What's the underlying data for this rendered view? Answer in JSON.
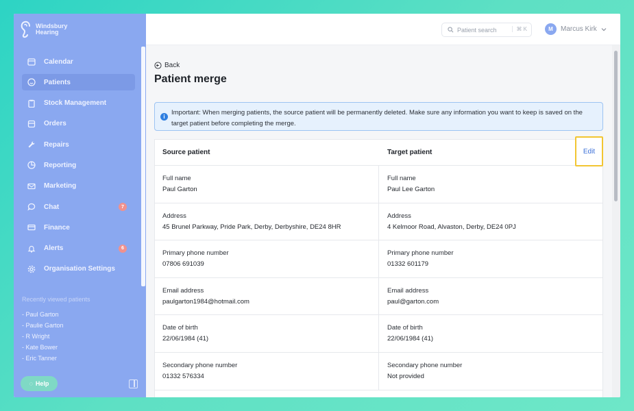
{
  "brand": {
    "name": "Windsbury Hearing"
  },
  "sidebar": {
    "items": [
      {
        "label": "Calendar",
        "icon": "calendar-icon"
      },
      {
        "label": "Patients",
        "icon": "smile-icon",
        "active": true
      },
      {
        "label": "Stock Management",
        "icon": "clipboard-icon"
      },
      {
        "label": "Orders",
        "icon": "orders-icon"
      },
      {
        "label": "Repairs",
        "icon": "wrench-icon"
      },
      {
        "label": "Reporting",
        "icon": "pie-chart-icon"
      },
      {
        "label": "Marketing",
        "icon": "mail-icon"
      },
      {
        "label": "Chat",
        "icon": "chat-icon",
        "badge": "7"
      },
      {
        "label": "Finance",
        "icon": "card-icon"
      },
      {
        "label": "Alerts",
        "icon": "bell-icon",
        "badge": "6"
      },
      {
        "label": "Organisation Settings",
        "icon": "gear-icon"
      }
    ],
    "recent_title": "Recently viewed patients",
    "recent": [
      "- Paul Garton",
      "- Paulie Garton",
      "- R Wright",
      "- Kate Bower",
      "- Eric Tanner"
    ],
    "help_label": "Help"
  },
  "topbar": {
    "search_placeholder": "Patient search",
    "search_shortcut": "⌘ K",
    "user_initial": "M",
    "user_name": "Marcus Kirk"
  },
  "main": {
    "back_label": "Back",
    "title": "Patient merge",
    "alert": "Important: When merging patients, the source patient will be permanently deleted. Make sure any information you want to keep is saved on the target patient before completing the merge.",
    "source_header": "Source patient",
    "target_header": "Target patient",
    "edit_label": "Edit",
    "rows": [
      {
        "label": "Full name",
        "source": "Paul Garton",
        "target": "Paul Lee Garton"
      },
      {
        "label": "Address",
        "source": "45 Brunel Parkway, Pride Park, Derby, Derbyshire, DE24 8HR",
        "target": "4 Kelmoor Road, Alvaston, Derby, DE24 0PJ"
      },
      {
        "label": "Primary phone number",
        "source": "07806 691039",
        "target": "01332 601179"
      },
      {
        "label": "Email address",
        "source": "paulgarton1984@hotmail.com",
        "target": "paul@garton.com"
      },
      {
        "label": "Date of birth",
        "source": "22/06/1984 (41)",
        "target": "22/06/1984 (41)"
      },
      {
        "label": "Secondary phone number",
        "source": "01332 576334",
        "target": "Not provided"
      }
    ]
  },
  "colors": {
    "sidebar": "#8aa8f0",
    "accent": "#3b6fd8",
    "alert_bg": "#e6f1fd",
    "highlight": "#f2c531"
  }
}
